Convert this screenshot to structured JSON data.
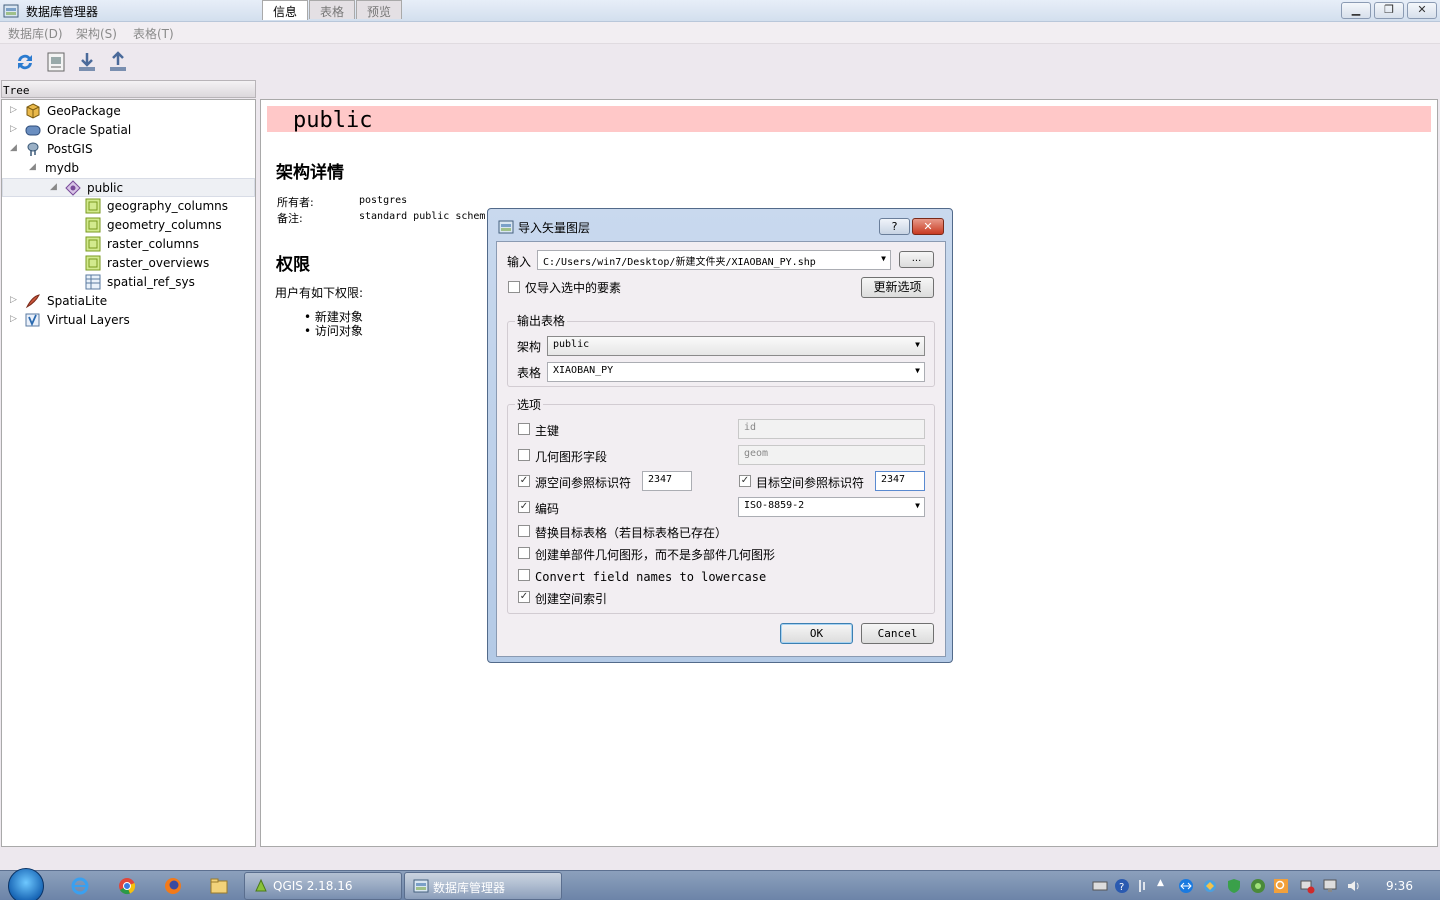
{
  "window": {
    "title": "数据库管理器"
  },
  "menu": [
    "数据库(D)",
    "架构(S)",
    "表格(T)"
  ],
  "tree": {
    "header": "Tree",
    "nodes": [
      {
        "label": "GeoPackage"
      },
      {
        "label": "Oracle Spatial"
      },
      {
        "label": "PostGIS"
      },
      {
        "label": "mydb"
      },
      {
        "label": "public"
      },
      {
        "label": "geography_columns"
      },
      {
        "label": "geometry_columns"
      },
      {
        "label": "raster_columns"
      },
      {
        "label": "raster_overviews"
      },
      {
        "label": "spatial_ref_sys"
      },
      {
        "label": "SpatiaLite"
      },
      {
        "label": "Virtual Layers"
      }
    ]
  },
  "tabs": [
    "信息",
    "表格",
    "预览"
  ],
  "info": {
    "schema_name": "public",
    "details_heading": "架构详情",
    "owner_label": "所有者:",
    "owner_value": "postgres",
    "comment_label": "备注:",
    "comment_value": "standard public schem",
    "privileges_heading": "权限",
    "privileges_text": "用户有如下权限:",
    "privileges": [
      "新建对象",
      "访问对象"
    ]
  },
  "dialog": {
    "title": "导入矢量图层",
    "help": "?",
    "close": "✕",
    "input_label": "输入",
    "input_value": "C:/Users/win7/Desktop/新建文件夹/XIAOBAN_PY.shp",
    "browse": "...",
    "selected_only": "仅导入选中的要素",
    "update_options": "更新选项",
    "output_group": "输出表格",
    "schema_label": "架构",
    "schema_value": "public",
    "table_label": "表格",
    "table_value": "XIAOBAN_PY",
    "options_group": "选项",
    "primary_key": {
      "label": "主键",
      "value": "id",
      "checked": false
    },
    "geom_field": {
      "label": "几何图形字段",
      "value": "geom",
      "checked": false
    },
    "source_srid": {
      "label": "源空间参照标识符",
      "value": "2347",
      "checked": true
    },
    "target_srid": {
      "label": "目标空间参照标识符",
      "value": "2347",
      "checked": true
    },
    "encoding": {
      "label": "编码",
      "value": "ISO-8859-2",
      "checked": true
    },
    "replace_table": {
      "label": "替换目标表格（若目标表格已存在）",
      "checked": false
    },
    "single_part": {
      "label": "创建单部件几何图形，而不是多部件几何图形",
      "checked": false
    },
    "lowercase": {
      "label": "Convert field names to lowercase",
      "checked": false
    },
    "spatial_index": {
      "label": "创建空间索引",
      "checked": true
    },
    "ok": "OK",
    "cancel": "Cancel"
  },
  "taskbar": {
    "tasks": [
      "QGIS 2.18.16",
      "数据库管理器"
    ],
    "clock": "9:36"
  }
}
